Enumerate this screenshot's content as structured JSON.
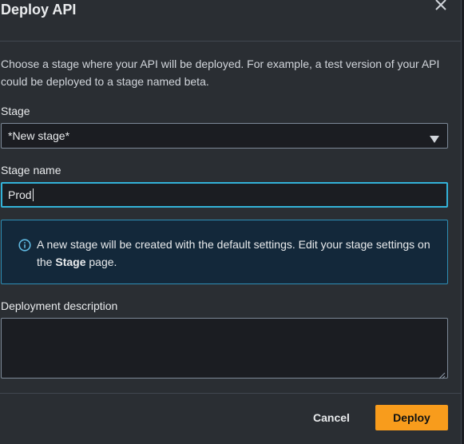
{
  "modal": {
    "title": "Deploy API",
    "close_icon": "close-icon",
    "intro": "Choose a stage where your API will be deployed. For example, a test version of your API could be deployed to a stage named beta."
  },
  "stage": {
    "label": "Stage",
    "selected": "*New stage*",
    "caret_icon": "caret-down-icon"
  },
  "stage_name": {
    "label": "Stage name",
    "value": "Prod"
  },
  "info": {
    "icon": "info-icon",
    "text_before": "A new stage will be created with the default settings. Edit your stage settings on the ",
    "text_bold": "Stage",
    "text_after": " page."
  },
  "description": {
    "label": "Deployment description",
    "value": ""
  },
  "footer": {
    "cancel_label": "Cancel",
    "deploy_label": "Deploy"
  },
  "colors": {
    "background": "#2a2e33",
    "input_background": "#1b1d22",
    "focus_border": "#33b2d8",
    "info_background": "#13283a",
    "primary_button": "#f89c1c"
  }
}
